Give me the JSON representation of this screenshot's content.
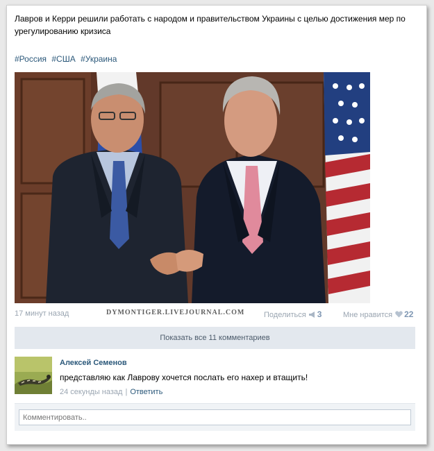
{
  "post": {
    "text": "Лавров и Керри решили работать с народом и правительством Украины с целью достижения мер по урегулированию кризиса",
    "hashtags": [
      "#Россия",
      "#США",
      "#Украина"
    ]
  },
  "meta": {
    "time": "17 минут назад",
    "watermark": "DYMONTIGER.LIVEJOURNAL.COM",
    "share_label": "Поделиться",
    "share_count": "3",
    "like_label": "Мне нравится",
    "like_count": "22"
  },
  "show_all_comments": "Показать все 11 комментариев",
  "comment": {
    "author": "Алексей Семенов",
    "text": "представляю как Лаврову хочется послать его нахер и втащить!",
    "time": "24 секунды назад",
    "separator": "|",
    "reply_label": "Ответить"
  },
  "comment_input": {
    "placeholder": "Комментировать.."
  },
  "icons": {
    "share": "megaphone-icon",
    "like": "heart-icon"
  },
  "colors": {
    "link": "#2b587a",
    "muted": "#9aa5b1",
    "bar": "#e3e8ee"
  }
}
